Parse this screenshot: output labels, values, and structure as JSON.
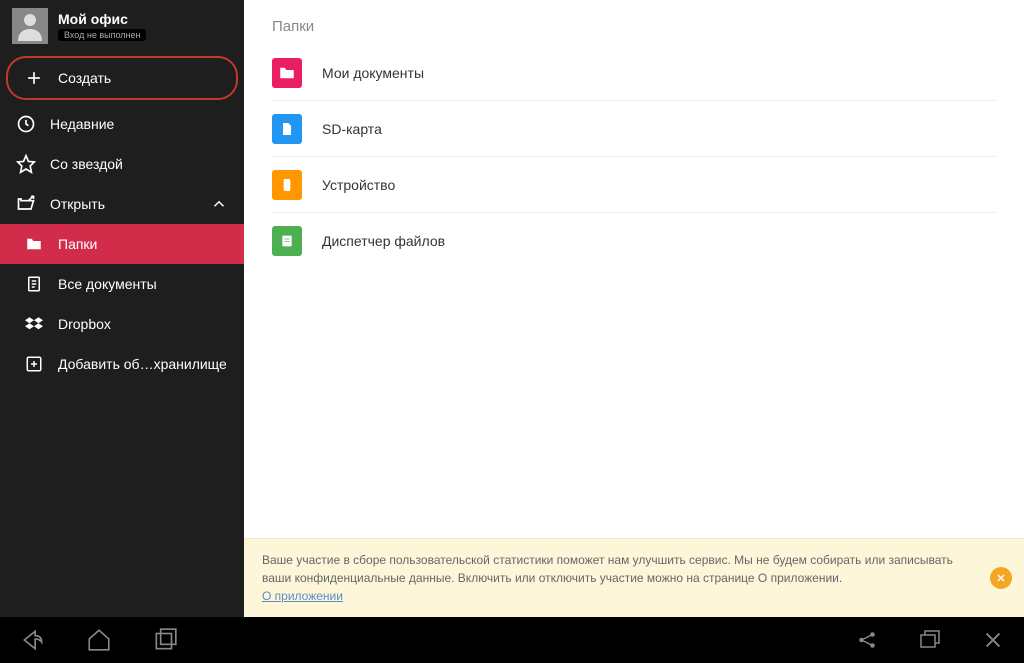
{
  "sidebar": {
    "user_name": "Мой офис",
    "user_status": "Вход не выполнен",
    "create_label": "Создать",
    "recent_label": "Недавние",
    "starred_label": "Со звездой",
    "open_label": "Открыть",
    "folders_label": "Папки",
    "all_docs_label": "Все документы",
    "dropbox_label": "Dropbox",
    "add_storage_label": "Добавить об…хранилище"
  },
  "main": {
    "section_title": "Папки",
    "folders": [
      {
        "label": "Мои документы",
        "icon": "folder",
        "color": "#e91e63"
      },
      {
        "label": "SD-карта",
        "icon": "sd",
        "color": "#2196f3"
      },
      {
        "label": "Устройство",
        "icon": "device",
        "color": "#ff9800"
      },
      {
        "label": "Диспетчер файлов",
        "icon": "files",
        "color": "#4caf50"
      }
    ]
  },
  "notice": {
    "text": "Ваше участие в сборе пользовательской статистики поможет нам улучшить сервис. Мы не будем собирать или записывать ваши конфиденциальные данные. Включить или отключить участие можно на странице О приложении.",
    "link_text": "О приложении"
  }
}
